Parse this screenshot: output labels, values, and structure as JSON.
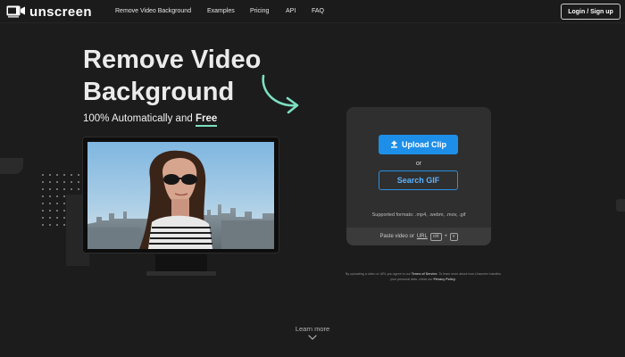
{
  "brand": {
    "name": "unscreen",
    "icon": "unscreen-logo-icon"
  },
  "nav": {
    "links": [
      "Remove Video Background",
      "Examples",
      "Pricing",
      "API",
      "FAQ"
    ],
    "login_label": "Login / Sign up"
  },
  "hero": {
    "title": "Remove Video Background",
    "subtitle_prefix": "100% Automatically and ",
    "subtitle_highlight": "Free"
  },
  "upload": {
    "upload_label": "Upload Clip",
    "or_label": "or",
    "gif_label": "Search GIF",
    "formats": "Supported formats: .mp4, .webm, .mov, .gif",
    "paste_prefix": "Paste video or",
    "paste_url": "URL",
    "key_ctrl": "ctrl",
    "key_plus": "+",
    "key_v": "v"
  },
  "terms": {
    "part1": "By uploading a video or URL you agree to our ",
    "terms_link": "Terms of Service",
    "part2": ". To learn more about how Unscreen handles your personal data, check our ",
    "privacy_link": "Privacy Policy",
    "part3": "."
  },
  "footer": {
    "learn_more": "Learn more"
  },
  "colors": {
    "background": "#1c1c1c",
    "panel": "#2f2f2f",
    "accent_blue": "#1e8fe8",
    "accent_mint": "#7be0c1"
  }
}
